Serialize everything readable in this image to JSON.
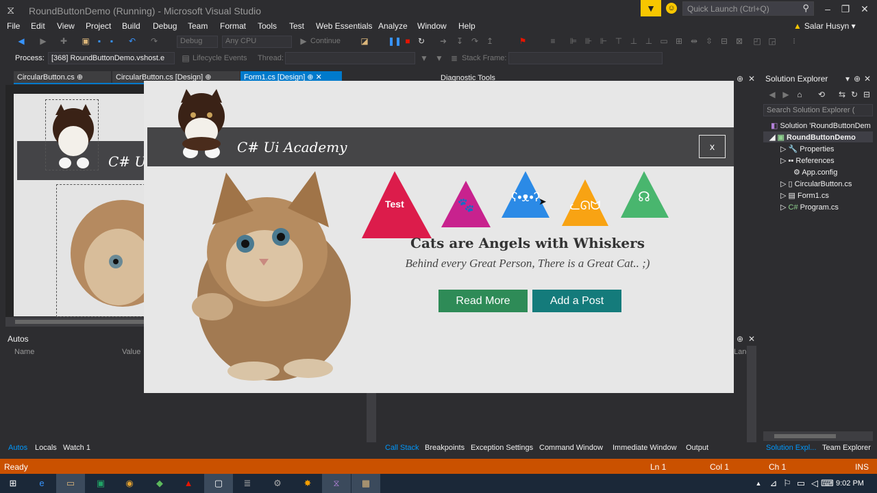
{
  "window": {
    "title": "RoundButtonDemo (Running) - Microsoft Visual Studio",
    "quick_launch_placeholder": "Quick Launch (Ctrl+Q)",
    "user": "Salar Husyn"
  },
  "menu": [
    "File",
    "Edit",
    "View",
    "Project",
    "Build",
    "Debug",
    "Team",
    "Format",
    "Tools",
    "Test",
    "Web Essentials",
    "Analyze",
    "Window",
    "Help"
  ],
  "toolbar": {
    "config": "Debug",
    "platform": "Any CPU",
    "continue_label": "Continue"
  },
  "toolbar2": {
    "process_label": "Process:",
    "process_value": "[368] RoundButtonDemo.vshost.e",
    "lifecycle_label": "Lifecycle Events",
    "thread_label": "Thread:",
    "stack_frame_label": "Stack Frame:"
  },
  "doc_tabs": [
    "CircularButton.cs",
    "CircularButton.cs [Design]",
    "Form1.cs [Design]"
  ],
  "designer": {
    "title": "C# U"
  },
  "autos": {
    "title": "Autos",
    "col_name": "Name",
    "col_value": "Value",
    "tabs": [
      "Autos",
      "Locals",
      "Watch 1"
    ]
  },
  "diagnostic": {
    "title": "Diagnostic Tools",
    "lang_col": "Lang",
    "tabs": [
      "Call Stack",
      "Breakpoints",
      "Exception Settings",
      "Command Window",
      "Immediate Window",
      "Output"
    ]
  },
  "solution_explorer": {
    "title": "Solution Explorer",
    "search_placeholder": "Search Solution Explorer (",
    "items": [
      "Solution 'RoundButtonDem",
      "RoundButtonDemo",
      "Properties",
      "References",
      "App.config",
      "CircularButton.cs",
      "Form1.cs",
      "Program.cs"
    ],
    "tabs": [
      "Solution Expl...",
      "Team Explorer"
    ]
  },
  "statusbar": {
    "left": "Ready",
    "ln": "Ln 1",
    "col": "Col 1",
    "ch": "Ch 1",
    "mode": "INS"
  },
  "taskbar": {
    "clock": "9:02 PM"
  },
  "app": {
    "title": "C# Ui Academy",
    "close_label": "x",
    "triangle_test_label": "Test",
    "headline": "Cats are Angels with Whiskers",
    "subline": "Behind every Great Person, There is a Great Cat.. ;)",
    "button_read_more": "Read More",
    "button_add_post": "Add a Post",
    "colors": {
      "tri_red": "#dc1c4b",
      "tri_magenta": "#c8228e",
      "tri_blue": "#2b8ae6",
      "tri_orange": "#f8a313",
      "tri_green": "#49b66e",
      "btn_green": "#2e8b57",
      "btn_teal": "#147b7b"
    }
  }
}
